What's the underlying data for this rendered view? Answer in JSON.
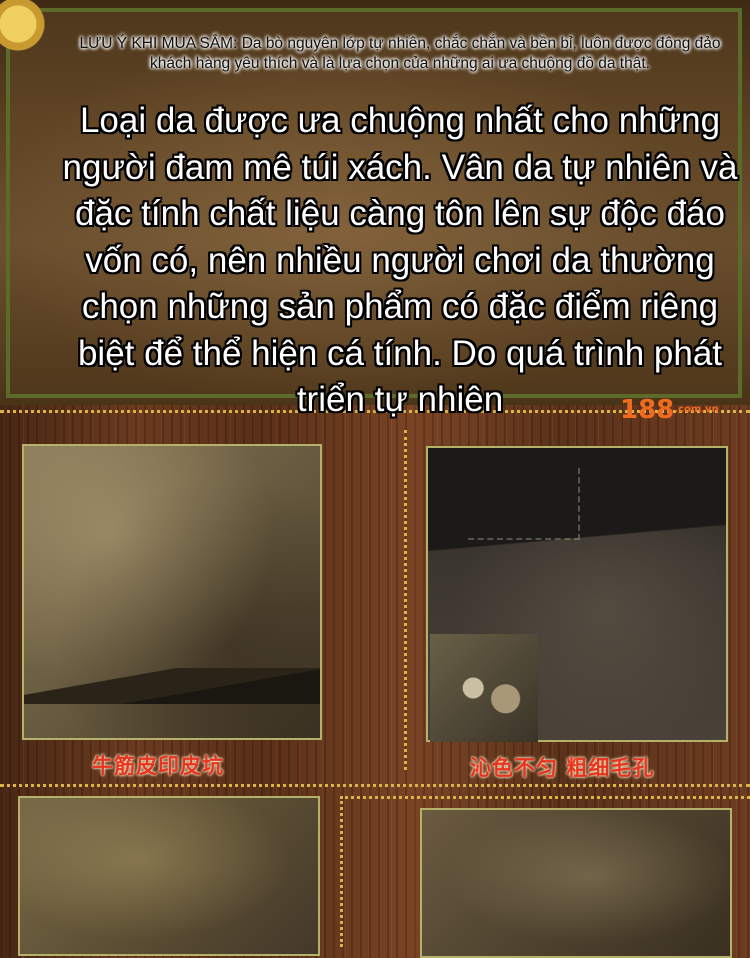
{
  "notice": {
    "text": "LƯU Ý KHI MUA SẮM: Da bò nguyên lớp tự nhiên, chắc chắn và bền bỉ, luôn được đông đảo khách hàng yêu thích và là lựa chọn của những ai ưa chuộng đồ da thật."
  },
  "main_text": "Loại da được ưa chuộng nhất cho những người đam mê túi xách. Vân da tự nhiên và đặc tính chất liệu càng tôn lên sự độc đáo vốn có, nên nhiều người chơi da thường chọn những sản phẩm có đặc điểm riêng biệt để thể hiện cá tính. Do quá trình phát triển tự nhiên",
  "photos": [
    {
      "caption": "牛筋皮印皮坑"
    },
    {
      "caption": "沁色不匀 粗细毛孔"
    }
  ],
  "watermark": {
    "main": "188",
    "suffix": ".com.vn"
  },
  "colors": {
    "caption": "#e8341e",
    "frame": "#b4b26a",
    "dotted_rule": "#d9b24a",
    "wood": "#6b3a1f"
  }
}
